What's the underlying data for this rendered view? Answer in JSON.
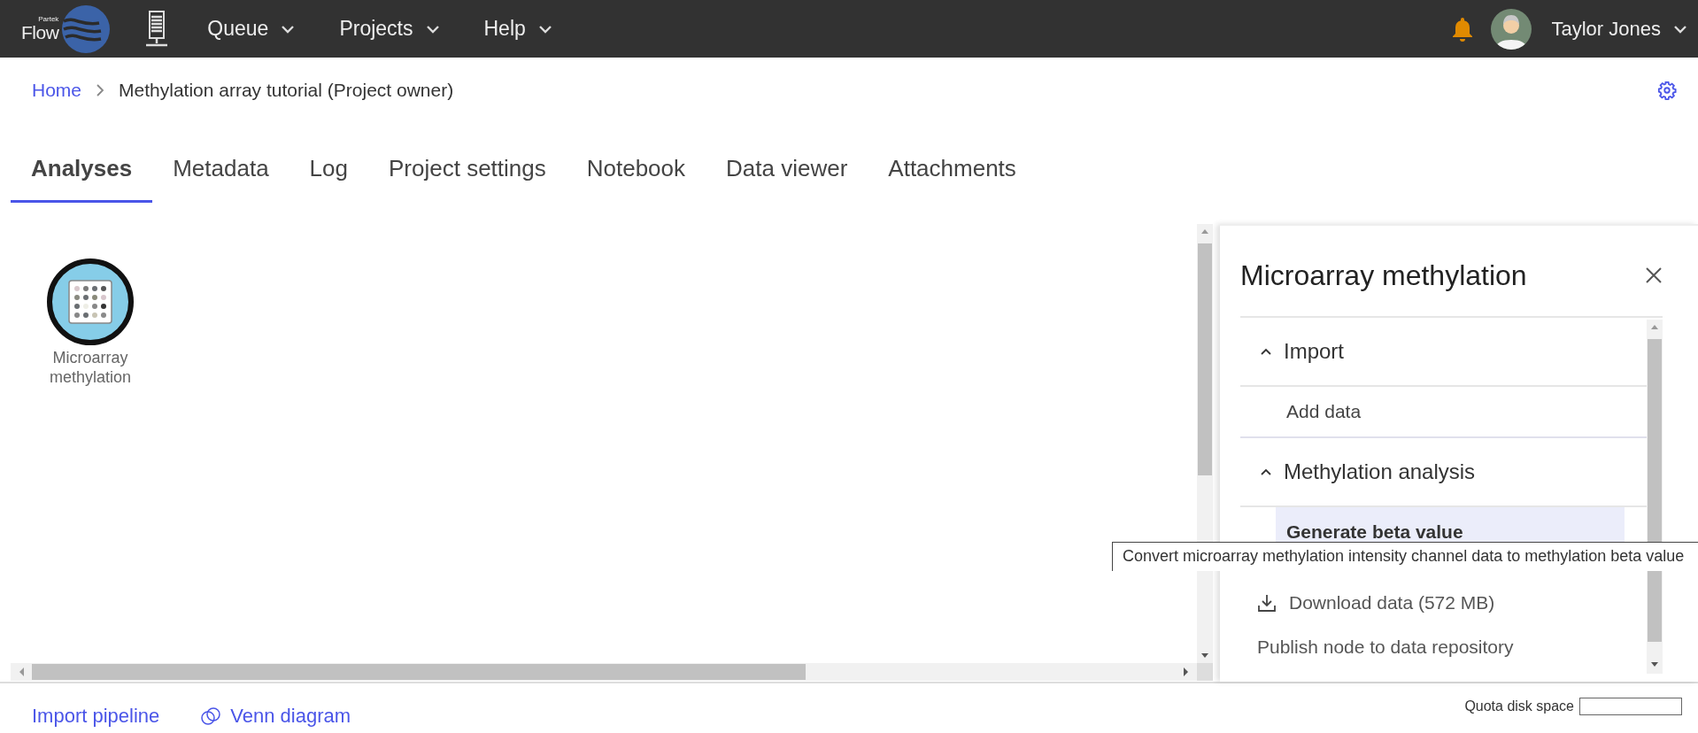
{
  "topbar": {
    "brand": {
      "small": "Partek",
      "name": "Flow"
    },
    "menus": [
      {
        "label": "Queue"
      },
      {
        "label": "Projects"
      },
      {
        "label": "Help"
      }
    ],
    "user": {
      "name": "Taylor Jones"
    }
  },
  "breadcrumb": [
    {
      "label": "Home",
      "kind": "link"
    },
    {
      "label": "Methylation array tutorial (Project owner)",
      "kind": "current"
    }
  ],
  "tabs": [
    {
      "label": "Analyses",
      "selected": true
    },
    {
      "label": "Metadata",
      "selected": false
    },
    {
      "label": "Log",
      "selected": false
    },
    {
      "label": "Project settings",
      "selected": false
    },
    {
      "label": "Notebook",
      "selected": false
    },
    {
      "label": "Data viewer",
      "selected": false
    },
    {
      "label": "Attachments",
      "selected": false
    }
  ],
  "canvas": {
    "nodes": [
      {
        "label": "Microarray methylation"
      }
    ]
  },
  "panel": {
    "title": "Microarray methylation",
    "sections": [
      {
        "title": "Import",
        "expanded": true,
        "items": [
          {
            "label": "Add data",
            "selected": false
          }
        ]
      },
      {
        "title": "Methylation analysis",
        "expanded": true,
        "items": [
          {
            "label": "Generate beta value",
            "selected": true
          }
        ]
      }
    ],
    "actions": [
      {
        "label": "Download data (572 MB)",
        "kind": "download"
      },
      {
        "label": "Publish node to data repository",
        "kind": "plain"
      }
    ]
  },
  "tooltip": {
    "text": "Convert microarray methylation intensity channel data to methylation beta value"
  },
  "footer": {
    "links": [
      {
        "label": "Import pipeline",
        "kind": "plain"
      },
      {
        "label": "Venn diagram",
        "kind": "venn"
      }
    ],
    "quota": {
      "label": "Quota disk space"
    }
  }
}
